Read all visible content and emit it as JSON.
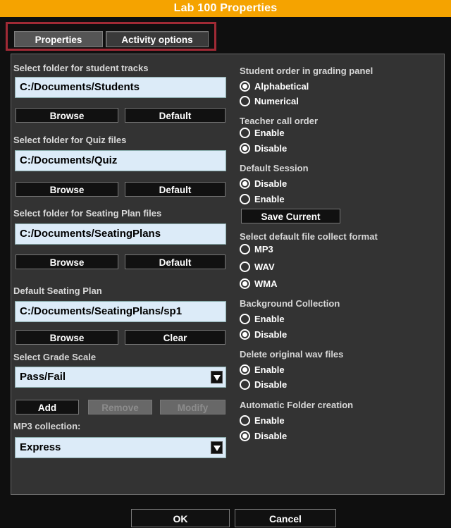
{
  "window": {
    "title": "Lab 100 Properties"
  },
  "tabs": [
    {
      "label": "Properties",
      "active": true
    },
    {
      "label": "Activity options",
      "active": false
    }
  ],
  "left": {
    "student_tracks": {
      "label": "Select folder for student tracks",
      "value": "C:/Documents/Students",
      "browse": "Browse",
      "default": "Default"
    },
    "quiz": {
      "label": "Select folder for Quiz files",
      "value": "C:/Documents/Quiz",
      "browse": "Browse",
      "default": "Default"
    },
    "seating": {
      "label": "Select folder for Seating Plan files",
      "value": "C:/Documents/SeatingPlans",
      "browse": "Browse",
      "default": "Default"
    },
    "default_plan": {
      "label": "Default Seating Plan",
      "value": "C:/Documents/SeatingPlans/sp1",
      "browse": "Browse",
      "clear": "Clear"
    },
    "grade_scale": {
      "label": "Select Grade Scale",
      "selected": "Pass/Fail",
      "add": "Add",
      "remove": "Remove",
      "modify": "Modify"
    },
    "mp3": {
      "label": "MP3 collection:",
      "selected": "Express"
    }
  },
  "right": {
    "student_order": {
      "label": "Student order in grading panel",
      "options": [
        "Alphabetical",
        "Numerical"
      ],
      "selected": "Alphabetical"
    },
    "teacher_call": {
      "label": "Teacher call order",
      "options": [
        "Enable",
        "Disable"
      ],
      "selected": "Disable"
    },
    "default_session": {
      "label": "Default Session",
      "options": [
        "Disable",
        "Enable"
      ],
      "selected": "Disable",
      "save_current": "Save Current"
    },
    "collect_format": {
      "label": "Select default file collect format",
      "options": [
        "MP3",
        "WAV",
        "WMA"
      ],
      "selected": "WMA"
    },
    "background": {
      "label": "Background Collection",
      "options": [
        "Enable",
        "Disable"
      ],
      "selected": "Disable"
    },
    "delete_wav": {
      "label": "Delete original wav files",
      "options": [
        "Enable",
        "Disable"
      ],
      "selected": "Enable"
    },
    "auto_folder": {
      "label": "Automatic Folder creation",
      "options": [
        "Enable",
        "Disable"
      ],
      "selected": "Disable"
    }
  },
  "footer": {
    "ok": "OK",
    "cancel": "Cancel"
  },
  "colors": {
    "titlebar": "#f5a300",
    "tab_border": "#a02a35",
    "field_bg": "#dcebf8",
    "panel_bg": "#333333"
  }
}
